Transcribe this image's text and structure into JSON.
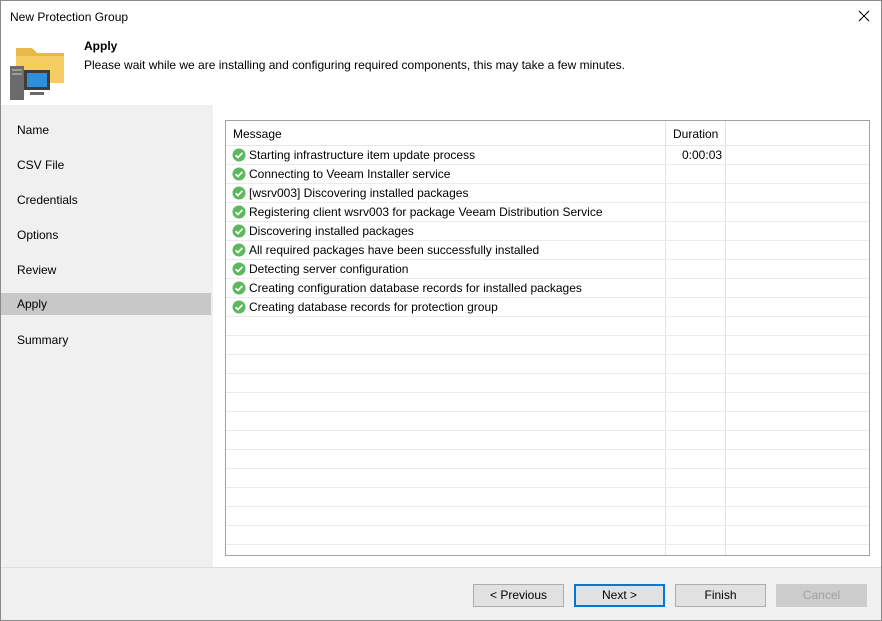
{
  "window": {
    "title": "New Protection Group"
  },
  "header": {
    "title": "Apply",
    "description": "Please wait while we are installing and configuring required components, this may take a few minutes.",
    "icon": "folder-computer-icon"
  },
  "sidebar": {
    "items": [
      {
        "label": "Name",
        "active": false
      },
      {
        "label": "CSV File",
        "active": false
      },
      {
        "label": "Credentials",
        "active": false
      },
      {
        "label": "Options",
        "active": false
      },
      {
        "label": "Review",
        "active": false
      },
      {
        "label": "Apply",
        "active": true
      },
      {
        "label": "Summary",
        "active": false
      }
    ]
  },
  "log": {
    "columns": {
      "message": "Message",
      "duration": "Duration"
    },
    "rows": [
      {
        "message": "Starting infrastructure item update process",
        "duration": "0:00:03",
        "status": "success"
      },
      {
        "message": "Connecting to Veeam Installer service",
        "duration": "",
        "status": "success"
      },
      {
        "message": "[wsrv003] Discovering installed packages",
        "duration": "",
        "status": "success"
      },
      {
        "message": "Registering client wsrv003 for package Veeam Distribution Service",
        "duration": "",
        "status": "success"
      },
      {
        "message": "Discovering installed packages",
        "duration": "",
        "status": "success"
      },
      {
        "message": "All required packages have been successfully installed",
        "duration": "",
        "status": "success"
      },
      {
        "message": "Detecting server configuration",
        "duration": "",
        "status": "success"
      },
      {
        "message": "Creating configuration database records for installed packages",
        "duration": "",
        "status": "success"
      },
      {
        "message": "Creating database records for protection group",
        "duration": "",
        "status": "success"
      }
    ]
  },
  "footer": {
    "previous": "< Previous",
    "next": "Next >",
    "finish": "Finish",
    "cancel": "Cancel"
  },
  "colors": {
    "success": "#5cb85c",
    "active_nav": "#c8c8c8",
    "primary_border": "#0078d7"
  }
}
